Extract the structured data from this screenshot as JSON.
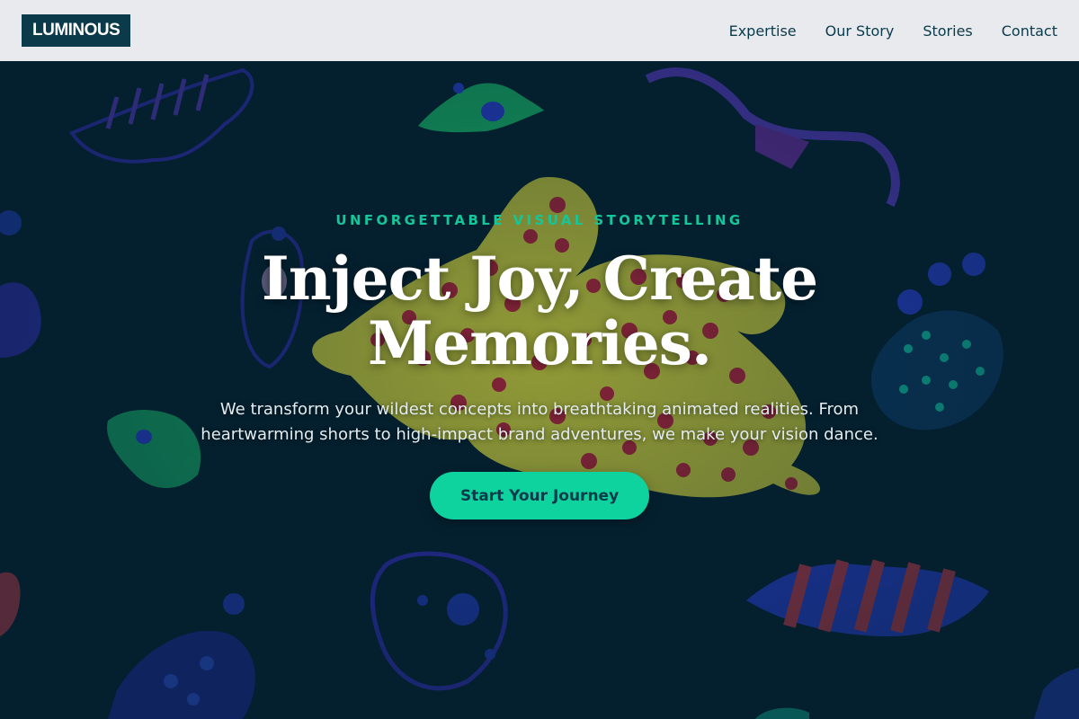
{
  "brand": {
    "logo_text": "LUMINOUS"
  },
  "nav": {
    "items": [
      {
        "label": "Expertise"
      },
      {
        "label": "Our Story"
      },
      {
        "label": "Stories"
      },
      {
        "label": "Contact"
      }
    ]
  },
  "hero": {
    "eyebrow": "UNFORGETTABLE VISUAL STORYTELLING",
    "title": "Inject Joy, Create Memories.",
    "subtitle": "We transform your wildest concepts into breathtaking animated realities. From heartwarming shorts to high-impact brand adventures, we make your vision dance.",
    "cta_label": "Start Your Journey"
  },
  "colors": {
    "nav_bg": "#e8eaed",
    "logo_bg": "#0b3a4a",
    "hero_bg": "#04202f",
    "accent": "#0fd39f",
    "eyebrow": "#14c79a"
  }
}
